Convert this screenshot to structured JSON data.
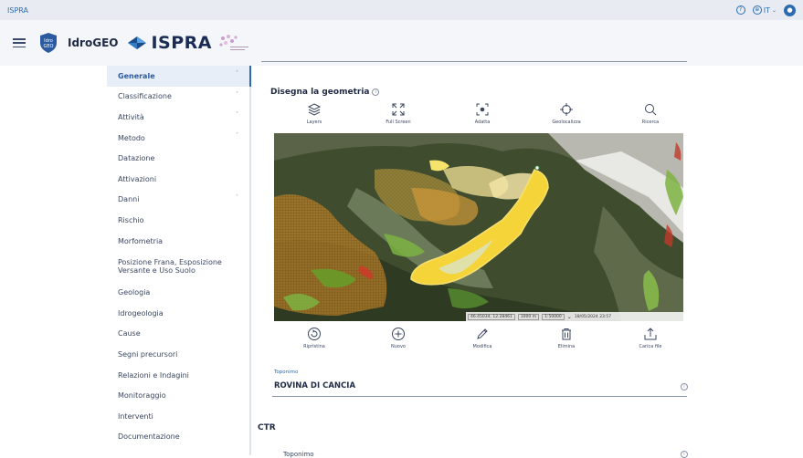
{
  "topbar": {
    "brand": "ISPRA",
    "help_icon": "help-circle-icon",
    "language": "IT",
    "language_icon": "globe-icon",
    "user_icon": "user-avatar-icon"
  },
  "header": {
    "app_name": "IdroGEO",
    "org_name": "ISPRA",
    "shield_text": "Idro GEO"
  },
  "sidebar": {
    "items": [
      {
        "label": "Generale",
        "active": true,
        "caret": true
      },
      {
        "label": "Classificazione",
        "caret": true
      },
      {
        "label": "Attività",
        "caret": true
      },
      {
        "label": "Metodo",
        "caret": true
      },
      {
        "label": "Datazione"
      },
      {
        "label": "Attivazioni"
      },
      {
        "label": "Danni",
        "caret": true
      },
      {
        "label": "Rischio"
      },
      {
        "label": "Morfometria"
      },
      {
        "label": "Posizione Frana, Esposizione Versante e Uso Suolo",
        "two_line": true
      },
      {
        "label": "Geologia"
      },
      {
        "label": "Idrogeologia"
      },
      {
        "label": "Cause"
      },
      {
        "label": "Segni precursori"
      },
      {
        "label": "Relazioni e Indagini"
      },
      {
        "label": "Monitoraggio"
      },
      {
        "label": "Interventi"
      },
      {
        "label": "Documentazione"
      }
    ]
  },
  "main": {
    "section_title": "Disegna la geometria",
    "tools_top": [
      {
        "label": "Layers",
        "icon": "layers-icon"
      },
      {
        "label": "Full Screen",
        "icon": "fullscreen-icon"
      },
      {
        "label": "Adatta",
        "icon": "fit-icon"
      },
      {
        "label": "Geolocalizza",
        "icon": "crosshair-icon"
      },
      {
        "label": "Ricerca",
        "icon": "search-icon"
      }
    ],
    "map": {
      "coords": "46.45034, 12.28461",
      "scale": "1000 m",
      "scale_ratio": "1:50000",
      "datetime": "18/05/2024 23:57"
    },
    "tools_bottom": [
      {
        "label": "Ripristina",
        "icon": "restore-icon"
      },
      {
        "label": "Nuovo",
        "icon": "plus-circle-icon"
      },
      {
        "label": "Modifica",
        "icon": "pencil-icon"
      },
      {
        "label": "Elimina",
        "icon": "trash-icon"
      },
      {
        "label": "Carica file",
        "icon": "upload-icon"
      }
    ],
    "toponimo_label": "Toponimo",
    "toponimo_value": "ROVINA DI CANCIA",
    "ctr_title": "CTR",
    "ctr_toponimo_label": "Toponimo"
  },
  "colors": {
    "accent": "#2b6cb0",
    "sidebar_active_bg": "#e8eef8",
    "landslide_yellow": "#f5d43a"
  }
}
